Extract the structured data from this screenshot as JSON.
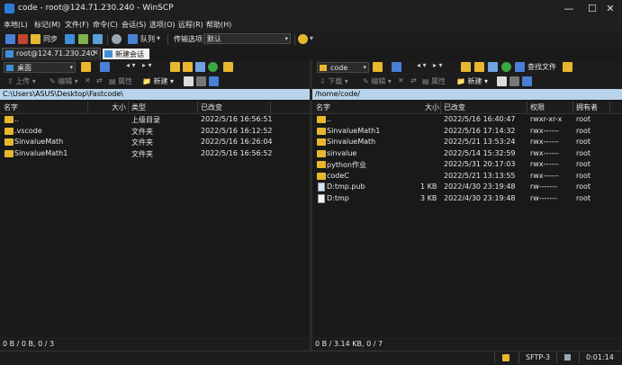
{
  "window": {
    "title": "code - root@124.71.230.240 - WinSCP",
    "controls": [
      "—",
      "☐",
      "✕"
    ]
  },
  "menu": [
    "本地(L)",
    "标记(M)",
    "文件(F)",
    "命令(C)",
    "会话(S)",
    "选项(O)",
    "远程(R)",
    "帮助(H)"
  ],
  "toolbar": {
    "sync_label": "同步",
    "queue_label": "队列",
    "transfer_options_label": "传输选项",
    "transfer_preset": "默认"
  },
  "tabs": {
    "session_label": "root@124.71.230.240",
    "new_session_label": "新建会话"
  },
  "left": {
    "location": "桌面",
    "toolbar": {
      "upload": "上传",
      "edit": "编辑",
      "properties": "属性",
      "new": "新建"
    },
    "path": "C:\\Users\\ASUS\\Desktop\\Fastcode\\",
    "columns": [
      "名字",
      "大小",
      "类型",
      "已改变"
    ],
    "rows": [
      {
        "name": "..",
        "size": "",
        "type": "上级目录",
        "modified": "2022/5/16  16:56:51"
      },
      {
        "name": ".vscode",
        "size": "",
        "type": "文件夹",
        "modified": "2022/5/16  16:12:52"
      },
      {
        "name": "SinvalueMath",
        "size": "",
        "type": "文件夹",
        "modified": "2022/5/16  16:26:04"
      },
      {
        "name": "SinvalueMath1",
        "size": "",
        "type": "文件夹",
        "modified": "2022/5/16  16:56:52"
      }
    ],
    "status": "0 B / 0 B,   0 / 3"
  },
  "right": {
    "location": "code",
    "find_files": "查找文件",
    "toolbar": {
      "download": "下载",
      "edit": "编辑",
      "properties": "属性",
      "new": "新建"
    },
    "path": "/home/code/",
    "columns": [
      "名字",
      "大小",
      "已改变",
      "权限",
      "拥有者"
    ],
    "rows": [
      {
        "name": "..",
        "size": "",
        "modified": "2022/5/16 16:40:47",
        "perm": "rwxr-xr-x",
        "owner": "root",
        "kind": "up"
      },
      {
        "name": "SinvalueMath1",
        "size": "",
        "modified": "2022/5/16 17:14:32",
        "perm": "rwx------",
        "owner": "root",
        "kind": "folder"
      },
      {
        "name": "SinvalueMath",
        "size": "",
        "modified": "2022/5/21 13:53:24",
        "perm": "rwx------",
        "owner": "root",
        "kind": "folder"
      },
      {
        "name": "sinvalue",
        "size": "",
        "modified": "2022/5/14 15:32:59",
        "perm": "rwx------",
        "owner": "root",
        "kind": "folder"
      },
      {
        "name": "python作业",
        "size": "",
        "modified": "2022/5/31 20:17:03",
        "perm": "rwx------",
        "owner": "root",
        "kind": "folder"
      },
      {
        "name": "codeC",
        "size": "",
        "modified": "2022/5/21 13:13:55",
        "perm": "rwx------",
        "owner": "root",
        "kind": "folder"
      },
      {
        "name": "D:tmp.pub",
        "size": "1 KB",
        "modified": "2022/4/30 23:19:48",
        "perm": "rw-------",
        "owner": "root",
        "kind": "pub"
      },
      {
        "name": "D:tmp",
        "size": "3 KB",
        "modified": "2022/4/30 23:19:48",
        "perm": "rw-------",
        "owner": "root",
        "kind": "file"
      }
    ],
    "status": "0 B / 3.14 KB,   0 / 7"
  },
  "statusbar": {
    "protocol": "SFTP-3",
    "elapsed": "0:01:14"
  },
  "colors": {
    "path_bar": "#b9d4ea",
    "folder": "#e8b730",
    "background": "#191919"
  }
}
